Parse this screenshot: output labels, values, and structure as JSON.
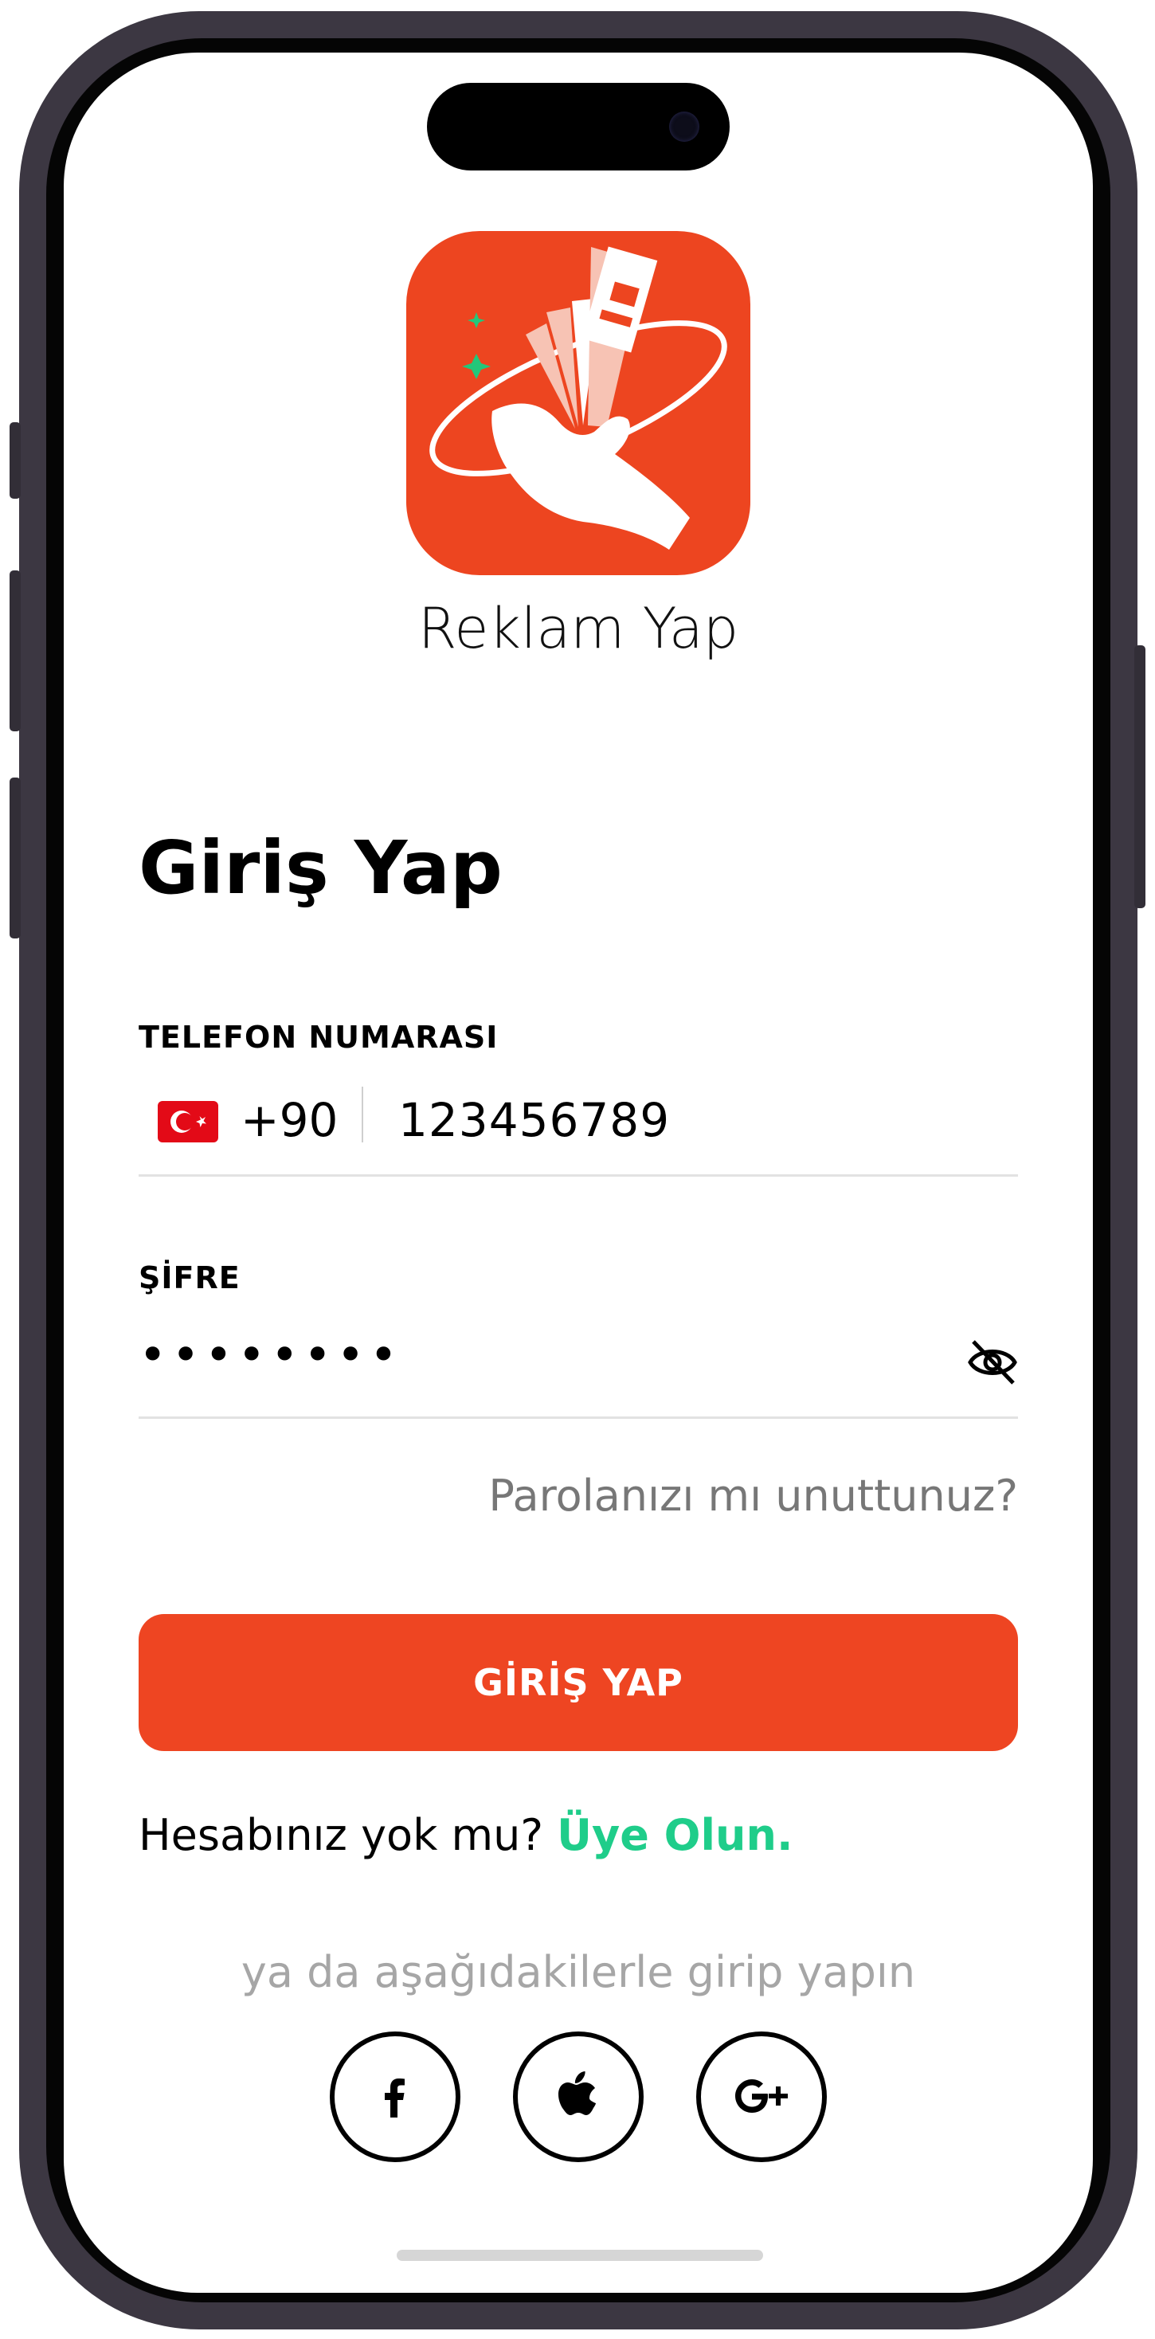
{
  "app": {
    "name": "Reklam Yap"
  },
  "login": {
    "title": "Giriş Yap",
    "phone_label": "TELEFON NUMARASI",
    "country_code": "+90",
    "phone_value": "123456789",
    "password_label": "ŞİFRE",
    "password_value": "••••••••",
    "forgot_password": "Parolanızı mı unuttunuz?",
    "submit_label": "GİRİŞ YAP"
  },
  "signup": {
    "prompt": "Hesabınız yok mu?",
    "link": "Üye Olun."
  },
  "social": {
    "text": "ya da aşağıdakilerle girip yapın",
    "providers": [
      "facebook-icon",
      "apple-icon",
      "google-plus-icon"
    ]
  },
  "colors": {
    "accent": "#ee4522",
    "link": "#1fcd8a"
  }
}
